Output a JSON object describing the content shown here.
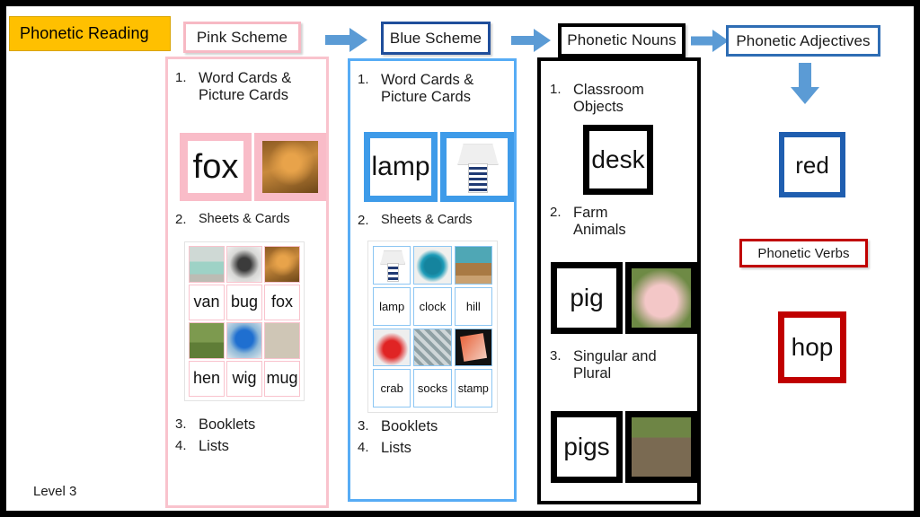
{
  "slide": {
    "title_badge": "Phonetic Reading",
    "level_label": "Level 3"
  },
  "colors": {
    "title_bg": "#FFC000",
    "pink": "#F9C3CD",
    "pink_dark": "#F7B9C4",
    "blue_light": "#57ACF5",
    "blue_mid": "#3E9BE9",
    "blue_dark": "#1F4E9B",
    "blue_header": "#2E6DB4",
    "arrow": "#5B9BD5",
    "black": "#000000",
    "red": "#C00000"
  },
  "flow": {
    "arrow_pink_to_blue": "arrow-right-icon",
    "arrow_blue_to_nouns": "arrow-right-icon",
    "arrow_nouns_to_adjectives": "arrow-right-icon",
    "arrow_adjectives_down": "arrow-down-icon"
  },
  "pink_scheme": {
    "header": "Pink Scheme",
    "items": [
      {
        "num": "1.",
        "text": "Word Cards &\nPicture Cards"
      },
      {
        "num": "2.",
        "text": "Sheets & Cards"
      },
      {
        "num": "3.",
        "text": "Booklets"
      },
      {
        "num": "4.",
        "text": "Lists"
      }
    ],
    "word_card": "fox",
    "picture_card": "fox-photo",
    "sheet": {
      "rows": [
        {
          "type": "images",
          "cells": [
            "van-photo",
            "bug-photo",
            "fox-photo"
          ]
        },
        {
          "type": "words",
          "cells": [
            "van",
            "bug",
            "fox"
          ]
        },
        {
          "type": "images",
          "cells": [
            "hen-photo",
            "wig-photo",
            "mug-photo"
          ]
        },
        {
          "type": "words",
          "cells": [
            "hen",
            "wig",
            "mug"
          ]
        }
      ]
    }
  },
  "blue_scheme": {
    "header": "Blue Scheme",
    "items": [
      {
        "num": "1.",
        "text": "Word Cards &\nPicture Cards"
      },
      {
        "num": "2.",
        "text": "Sheets & Cards"
      },
      {
        "num": "3.",
        "text": "Booklets"
      },
      {
        "num": "4.",
        "text": "Lists"
      }
    ],
    "word_card": "lamp",
    "picture_card": "lamp-photo",
    "sheet": {
      "rows": [
        {
          "type": "images",
          "cells": [
            "lamp-photo",
            "clock-photo",
            "hill-photo"
          ]
        },
        {
          "type": "words",
          "cells": [
            "lamp",
            "clock",
            "hill"
          ]
        },
        {
          "type": "images",
          "cells": [
            "crab-photo",
            "socks-photo",
            "stamp-photo"
          ]
        },
        {
          "type": "words",
          "cells": [
            "crab",
            "socks",
            "stamp"
          ]
        }
      ]
    }
  },
  "phonetic_nouns": {
    "header": "Phonetic Nouns",
    "items": [
      {
        "num": "1.",
        "text": "Classroom\nObjects"
      },
      {
        "num": "2.",
        "text": "Farm\nAnimals"
      },
      {
        "num": "3.",
        "text": "Singular and\nPlural"
      }
    ],
    "cards": [
      {
        "word": "desk",
        "picture": null
      },
      {
        "word": "pig",
        "picture": "pig-photo"
      },
      {
        "word": "pigs",
        "picture": "pigs-photo"
      }
    ]
  },
  "phonetic_adjectives": {
    "header": "Phonetic Adjectives",
    "word_card": "red"
  },
  "phonetic_verbs": {
    "header": "Phonetic Verbs",
    "word_card": "hop"
  }
}
